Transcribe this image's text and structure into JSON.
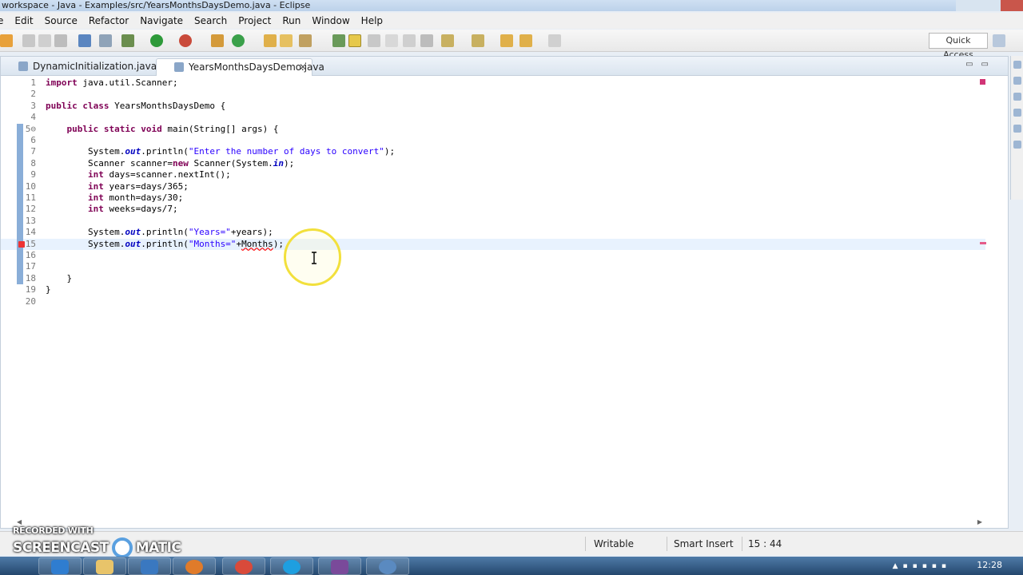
{
  "window": {
    "title": "workspace - Java - Examples/src/YearsMonthsDaysDemo.java - Eclipse"
  },
  "menu": [
    "e",
    "Edit",
    "Source",
    "Refactor",
    "Navigate",
    "Search",
    "Project",
    "Run",
    "Window",
    "Help"
  ],
  "toolbar": {
    "quick_access_label": "Quick Access"
  },
  "tabs": [
    {
      "label": "DynamicInitialization.java",
      "active": false
    },
    {
      "label": "YearsMonthsDaysDemo.java",
      "active": true
    }
  ],
  "code_lines": [
    {
      "num": "1",
      "text": "import java.util.Scanner;"
    },
    {
      "num": "2",
      "text": ""
    },
    {
      "num": "3",
      "text": "public class YearsMonthsDaysDemo {"
    },
    {
      "num": "4",
      "text": ""
    },
    {
      "num": "5⊖",
      "text": "    public static void main(String[] args) {"
    },
    {
      "num": "6",
      "text": ""
    },
    {
      "num": "7",
      "text": "        System.out.println(\"Enter the number of days to convert\");"
    },
    {
      "num": "8",
      "text": "        Scanner scanner=new Scanner(System.in);"
    },
    {
      "num": "9",
      "text": "        int days=scanner.nextInt();"
    },
    {
      "num": "10",
      "text": "        int years=days/365;"
    },
    {
      "num": "11",
      "text": "        int month=days/30;"
    },
    {
      "num": "12",
      "text": "        int weeks=days/7;"
    },
    {
      "num": "13",
      "text": ""
    },
    {
      "num": "14",
      "text": "        System.out.println(\"Years=\"+years);"
    },
    {
      "num": "15",
      "text": "        System.out.println(\"Months=\"+Months);"
    },
    {
      "num": "16",
      "text": ""
    },
    {
      "num": "17",
      "text": ""
    },
    {
      "num": "18",
      "text": "    }"
    },
    {
      "num": "19",
      "text": "}"
    },
    {
      "num": "20",
      "text": ""
    }
  ],
  "status": {
    "writable": "Writable",
    "insert_mode": "Smart Insert",
    "position": "15 : 44"
  },
  "watermark": {
    "line1": "RECORDED WITH",
    "line2a": "SCREENCAST",
    "line2b": "MATIC"
  },
  "taskbar": {
    "clock": "12:28"
  },
  "colors": {
    "keyword": "#7f0055",
    "string": "#2a00ff",
    "static_field": "#0000c0",
    "current_line": "#e8f2fe",
    "error": "#ff0000"
  }
}
